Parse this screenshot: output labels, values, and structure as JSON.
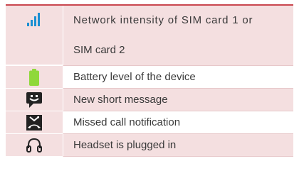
{
  "rows": [
    {
      "icon": "signal-strength-icon",
      "text_line1": "Network intensity of SIM card 1 or",
      "text_line2": "SIM card 2"
    },
    {
      "icon": "battery-icon",
      "text": "Battery level of the device"
    },
    {
      "icon": "new-message-icon",
      "text": "New short message"
    },
    {
      "icon": "missed-call-icon",
      "text": "Missed call notification"
    },
    {
      "icon": "headset-icon",
      "text": "Headset is plugged in"
    }
  ],
  "colors": {
    "header_rule": "#c9464e",
    "row_pink": "#f4dfe0",
    "signal_icon": "#1a8fd2",
    "battery_icon": "#8fd83a"
  }
}
